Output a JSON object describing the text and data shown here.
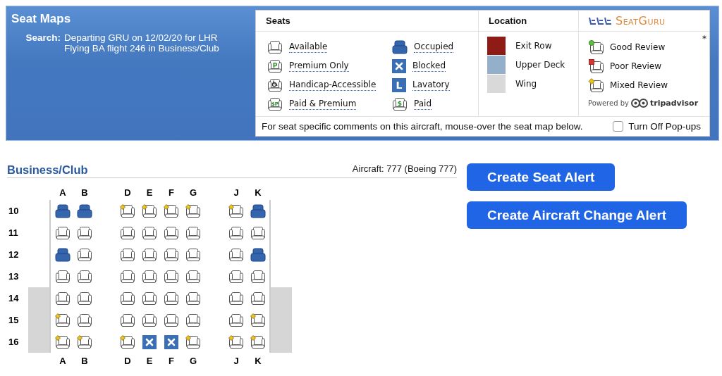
{
  "header": {
    "title": "Seat Maps",
    "search_label": "Search:",
    "search_lines": [
      "Departing GRU on 12/02/20 for LHR",
      "Flying BA flight 246 in Business/Club"
    ]
  },
  "legend": {
    "seats_heading": "Seats",
    "location_heading": "Location",
    "review_logo": "SeatGuru",
    "asterisk": "*",
    "seat_types": [
      {
        "label": "Available",
        "kind": "available"
      },
      {
        "label": "Premium Only",
        "kind": "glyph_seat",
        "glyph": "P"
      },
      {
        "label": "Handicap-Accessible",
        "kind": "handicap"
      },
      {
        "label": "Paid & Premium",
        "kind": "glyph_seat",
        "glyph": "$P"
      },
      {
        "label": "Occupied",
        "kind": "occupied"
      },
      {
        "label": "Blocked",
        "kind": "blocked"
      },
      {
        "label": "Lavatory",
        "kind": "glyph_block",
        "glyph": "L"
      },
      {
        "label": "Paid",
        "kind": "glyph_seat",
        "glyph": "$"
      }
    ],
    "locations": [
      {
        "label": "Exit Row",
        "color": "#8e1b16"
      },
      {
        "label": "Upper Deck",
        "color": "#93afca"
      },
      {
        "label": "Wing",
        "color": "#d9d9d9"
      }
    ],
    "reviews": [
      {
        "label": "Good Review",
        "kind": "good"
      },
      {
        "label": "Poor Review",
        "kind": "poor"
      },
      {
        "label": "Mixed Review",
        "kind": "mixed"
      }
    ],
    "powered_by": "Powered by",
    "tripadvisor": "tripadvisor",
    "footer_note": "For seat specific comments on this aircraft, mouse-over the seat map below.",
    "popups_checkbox": {
      "label": "Turn Off Pop-ups",
      "checked": false
    }
  },
  "seat_map": {
    "cabin_title": "Business/Club",
    "aircraft": "Aircraft: 777 (Boeing 777)",
    "column_groups_top": [
      [
        "A",
        "B"
      ],
      [
        "D",
        "E",
        "F",
        "G"
      ],
      [
        "J",
        "K"
      ]
    ],
    "rows": [
      {
        "number": "10",
        "wing": false,
        "seat_groups": [
          [
            {
              "kind": "occupied"
            },
            {
              "kind": "occupied"
            }
          ],
          [
            {
              "kind": "mixed"
            },
            {
              "kind": "mixed"
            },
            {
              "kind": "mixed"
            },
            {
              "kind": "mixed"
            }
          ],
          [
            {
              "kind": "mixed"
            },
            {
              "kind": "occupied"
            }
          ]
        ]
      },
      {
        "number": "11",
        "wing": false,
        "seat_groups": [
          [
            {
              "kind": "available"
            },
            {
              "kind": "available"
            }
          ],
          [
            {
              "kind": "available"
            },
            {
              "kind": "available"
            },
            {
              "kind": "available"
            },
            {
              "kind": "available"
            }
          ],
          [
            {
              "kind": "available"
            },
            {
              "kind": "available"
            }
          ]
        ]
      },
      {
        "number": "12",
        "wing": false,
        "seat_groups": [
          [
            {
              "kind": "occupied"
            },
            {
              "kind": "available"
            }
          ],
          [
            {
              "kind": "available"
            },
            {
              "kind": "available"
            },
            {
              "kind": "available"
            },
            {
              "kind": "available"
            }
          ],
          [
            {
              "kind": "available"
            },
            {
              "kind": "occupied"
            }
          ]
        ]
      },
      {
        "number": "13",
        "wing": false,
        "seat_groups": [
          [
            {
              "kind": "available"
            },
            {
              "kind": "available"
            }
          ],
          [
            {
              "kind": "available"
            },
            {
              "kind": "available"
            },
            {
              "kind": "available"
            },
            {
              "kind": "available"
            }
          ],
          [
            {
              "kind": "available"
            },
            {
              "kind": "available"
            }
          ]
        ]
      },
      {
        "number": "14",
        "wing": true,
        "seat_groups": [
          [
            {
              "kind": "available"
            },
            {
              "kind": "available"
            }
          ],
          [
            {
              "kind": "available"
            },
            {
              "kind": "available"
            },
            {
              "kind": "available"
            },
            {
              "kind": "available"
            }
          ],
          [
            {
              "kind": "available"
            },
            {
              "kind": "available"
            }
          ]
        ]
      },
      {
        "number": "15",
        "wing": true,
        "seat_groups": [
          [
            {
              "kind": "mixed"
            },
            {
              "kind": "available"
            }
          ],
          [
            {
              "kind": "available"
            },
            {
              "kind": "available"
            },
            {
              "kind": "available"
            },
            {
              "kind": "available"
            }
          ],
          [
            {
              "kind": "available"
            },
            {
              "kind": "mixed"
            }
          ]
        ]
      },
      {
        "number": "16",
        "wing": true,
        "seat_groups": [
          [
            {
              "kind": "mixed"
            },
            {
              "kind": "mixed"
            }
          ],
          [
            {
              "kind": "mixed"
            },
            {
              "kind": "blocked"
            },
            {
              "kind": "blocked"
            },
            {
              "kind": "mixed"
            }
          ],
          [
            {
              "kind": "mixed"
            },
            {
              "kind": "mixed"
            }
          ]
        ]
      }
    ],
    "column_groups_bottom": [
      [
        "A",
        "B"
      ],
      [
        "D",
        "E",
        "F",
        "G"
      ],
      [
        "J",
        "K"
      ]
    ]
  },
  "buttons": [
    "Create Seat Alert",
    "Create Aircraft Change Alert"
  ]
}
